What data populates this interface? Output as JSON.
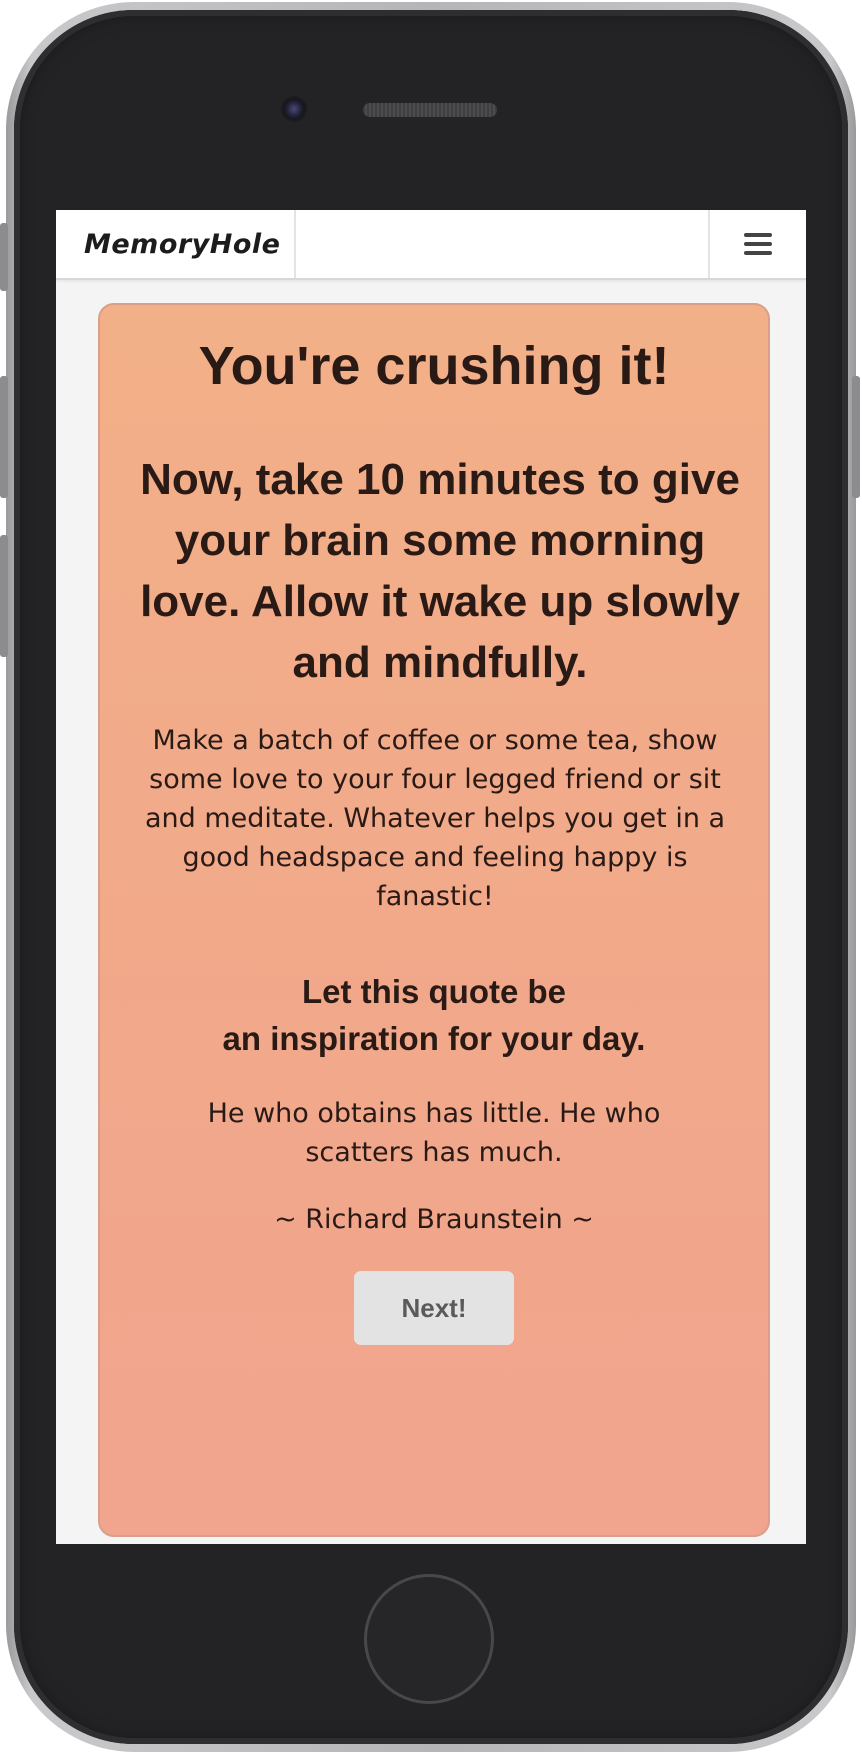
{
  "app": {
    "brand": "MemoryHole",
    "menu_icon": "hamburger-icon"
  },
  "card": {
    "heading": "You're crushing it!",
    "subheading": "Now, take 10 minutes to give your brain some morning love. Allow it wake up slowly and mindfully.",
    "body": "Make a batch of coffee or some tea, show some love to your four legged friend or sit and meditate. Whatever helps you get in a good headspace and feeling happy is fanastic!",
    "quote_intro_line1": "Let this quote be",
    "quote_intro_line2": "an inspiration for your day.",
    "quote": "He who obtains has little. He who scatters has much.",
    "author": "~ Richard Braunstein ~",
    "next_button": "Next!"
  },
  "colors": {
    "card_top": "#f2b088",
    "card_bottom": "#f1a48e",
    "text": "#2a1a16",
    "button_bg": "#e3e3e3",
    "button_text": "#5a5a5a"
  }
}
